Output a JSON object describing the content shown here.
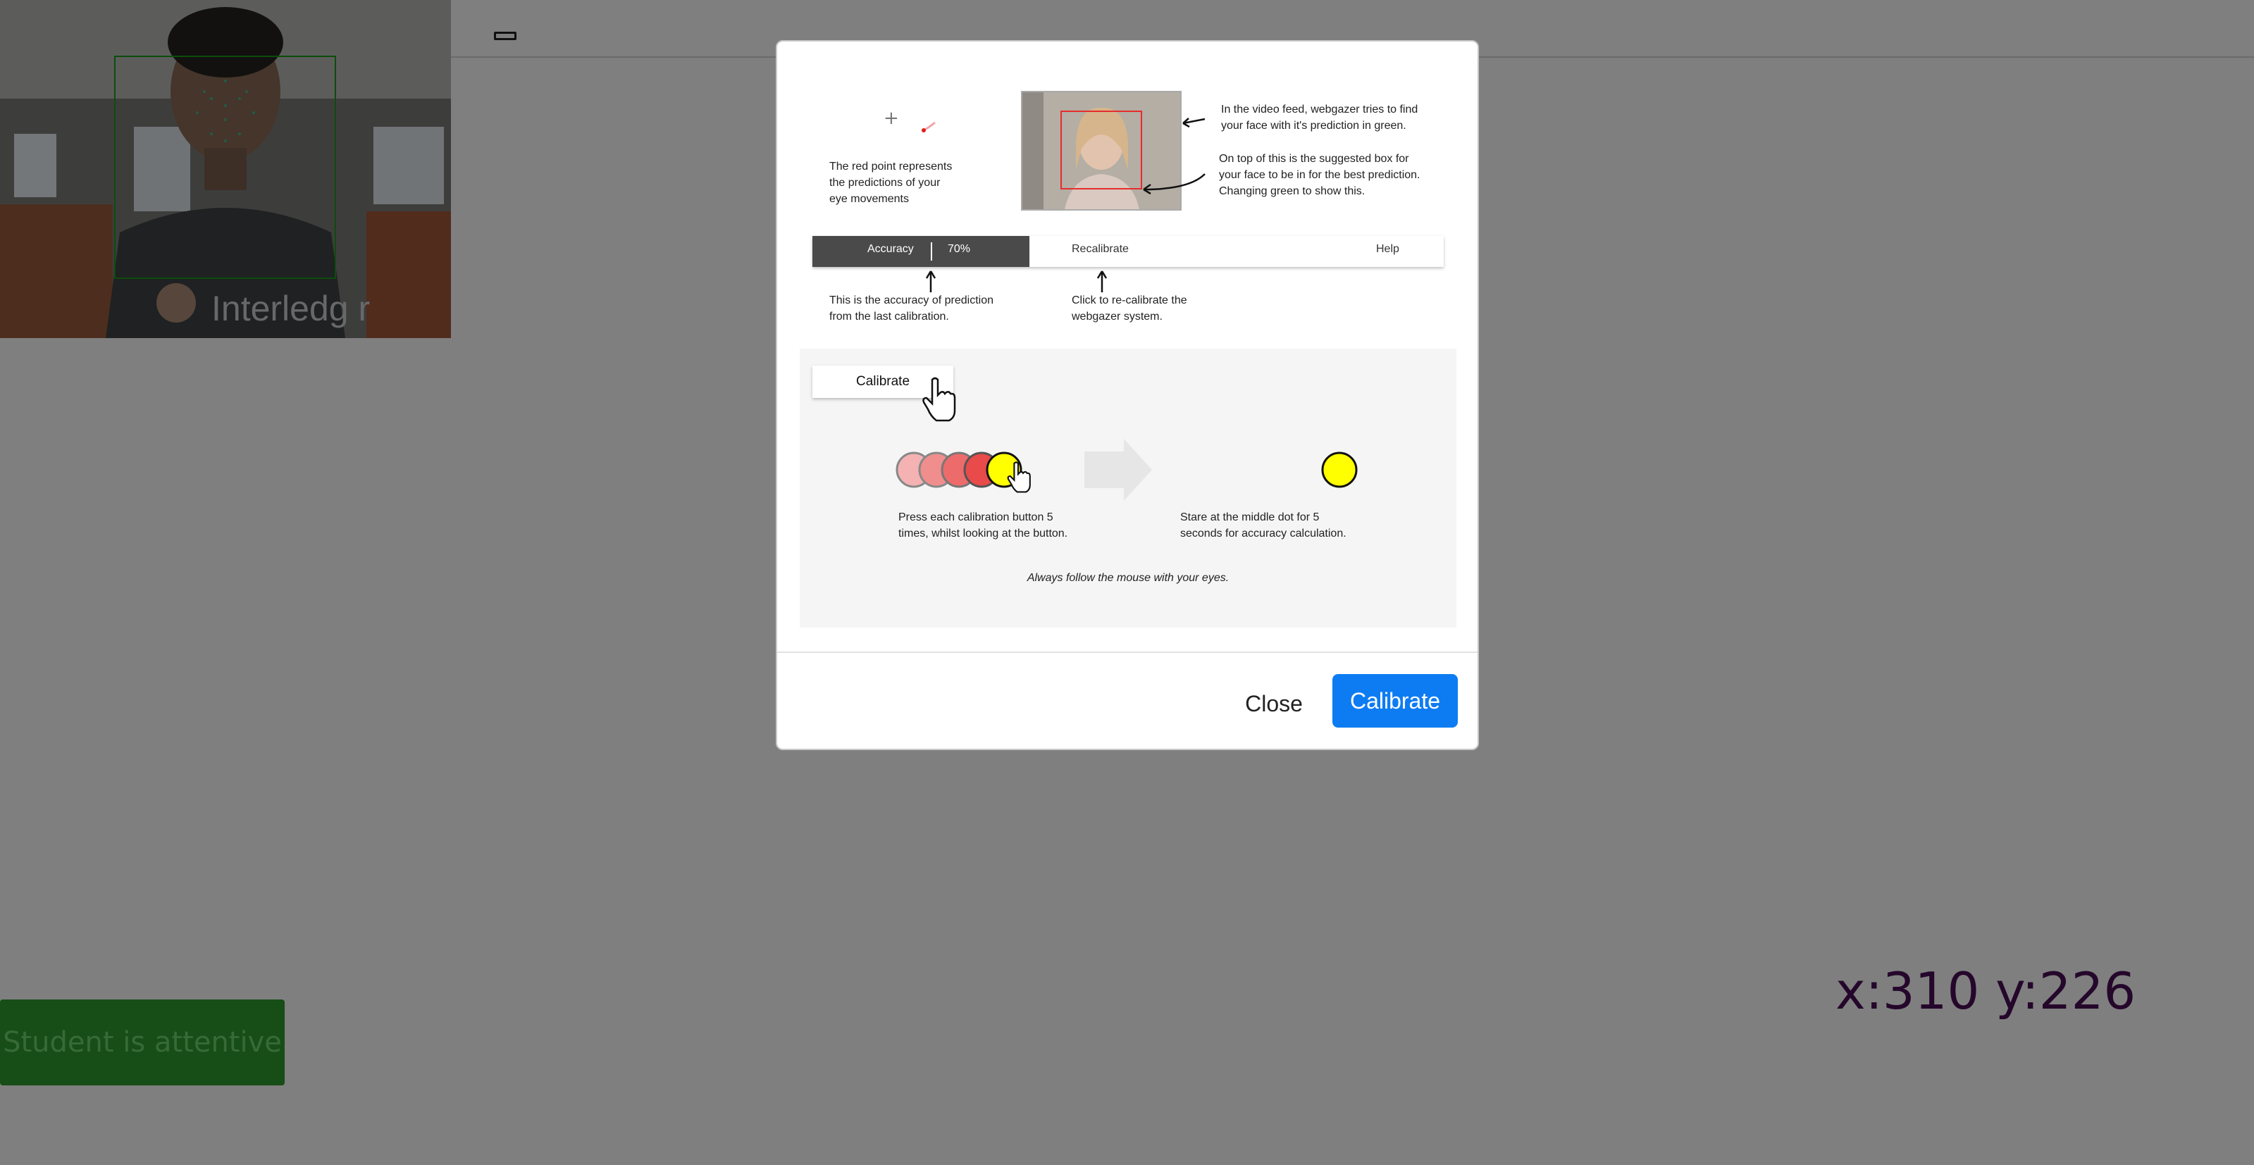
{
  "page": {
    "status_badge": "Student is attentive",
    "coordinates": "x:310 y:226"
  },
  "modal": {
    "instructions": {
      "red_point_text": [
        "The red point represents",
        "the predictions of your",
        "eye movements"
      ],
      "video_feed_text": [
        "In the video feed, webgazer tries to find",
        "your face with it's prediction in green."
      ],
      "suggested_box_text": [
        "On top of this is the suggested box for",
        "your face to be in for the best prediction.",
        "Changing green to show this."
      ],
      "accuracy_label": "Accuracy",
      "accuracy_value": "70%",
      "recalibrate_label": "Recalibrate",
      "help_label": "Help",
      "accuracy_text": [
        "This is the accuracy of prediction",
        "from the last calibration."
      ],
      "recalibrate_text": [
        "Click to re-calibrate the",
        "webgazer system."
      ],
      "calibrate_label": "Calibrate",
      "press_text": [
        "Press each calibration button 5",
        "times, whilst looking at the button."
      ],
      "stare_text": [
        "Stare at the middle dot for 5",
        "seconds for accuracy calculation."
      ],
      "follow_text": "Always follow the mouse with your eyes."
    },
    "footer": {
      "close_label": "Close",
      "calibrate_label": "Calibrate"
    }
  },
  "colors": {
    "primary_button": "#0d7cf2",
    "status_badge_bg": "#2e9b2e",
    "coordinate_text": "#4b0f56",
    "calibration_dot": "#ffff00"
  },
  "icons": [
    "crosshair-icon",
    "pointer-hand-icon",
    "arrow-icon"
  ]
}
